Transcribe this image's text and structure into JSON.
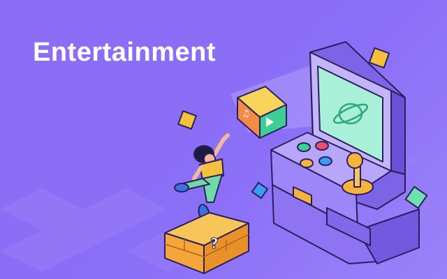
{
  "banner": {
    "title": "Entertainment",
    "colors": {
      "background": "#8b6cf5",
      "title": "#ffffff",
      "machine_body": "#9d86f7",
      "screen": "#a8f0d8",
      "block": "#f5a63b"
    },
    "icons": [
      "arcade-machine-icon",
      "joystick-icon",
      "music-note-icon",
      "play-icon",
      "question-mark-icon"
    ]
  }
}
